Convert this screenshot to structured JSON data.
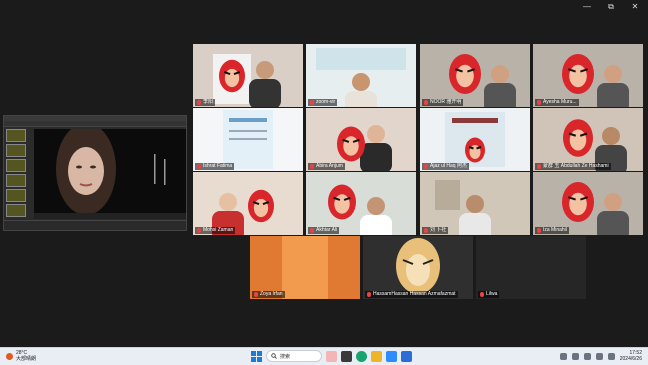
{
  "window": {
    "minimize": "—",
    "maximize": "⧉",
    "close": "✕"
  },
  "participants": [
    {
      "name": "李阳"
    },
    {
      "name": "zoom-vir"
    },
    {
      "name": "NOOR 雅开明"
    },
    {
      "name": "Ayesha Muru..."
    },
    {
      "name": "Ishrat Fatima"
    },
    {
      "name": "Abira Anjum"
    },
    {
      "name": "Ajaz ul Haq 阿杰"
    },
    {
      "name": "蒙群 玉 Abdullah Ze Hashami"
    },
    {
      "name": "Mohsi Zaman"
    },
    {
      "name": "Akhtar Ali"
    },
    {
      "name": "刘 卜社"
    },
    {
      "name": "Iza Minahil"
    },
    {
      "name": "Zoya Irfan"
    },
    {
      "name": "HassamHassan Hassan Azmafazmat"
    },
    {
      "name": "Lilwa"
    }
  ],
  "taskbar": {
    "weather_temp": "28°C",
    "weather_desc": "大部晴朗",
    "search_placeholder": "搜索",
    "time": "17:52",
    "date": "2024/6/26"
  }
}
